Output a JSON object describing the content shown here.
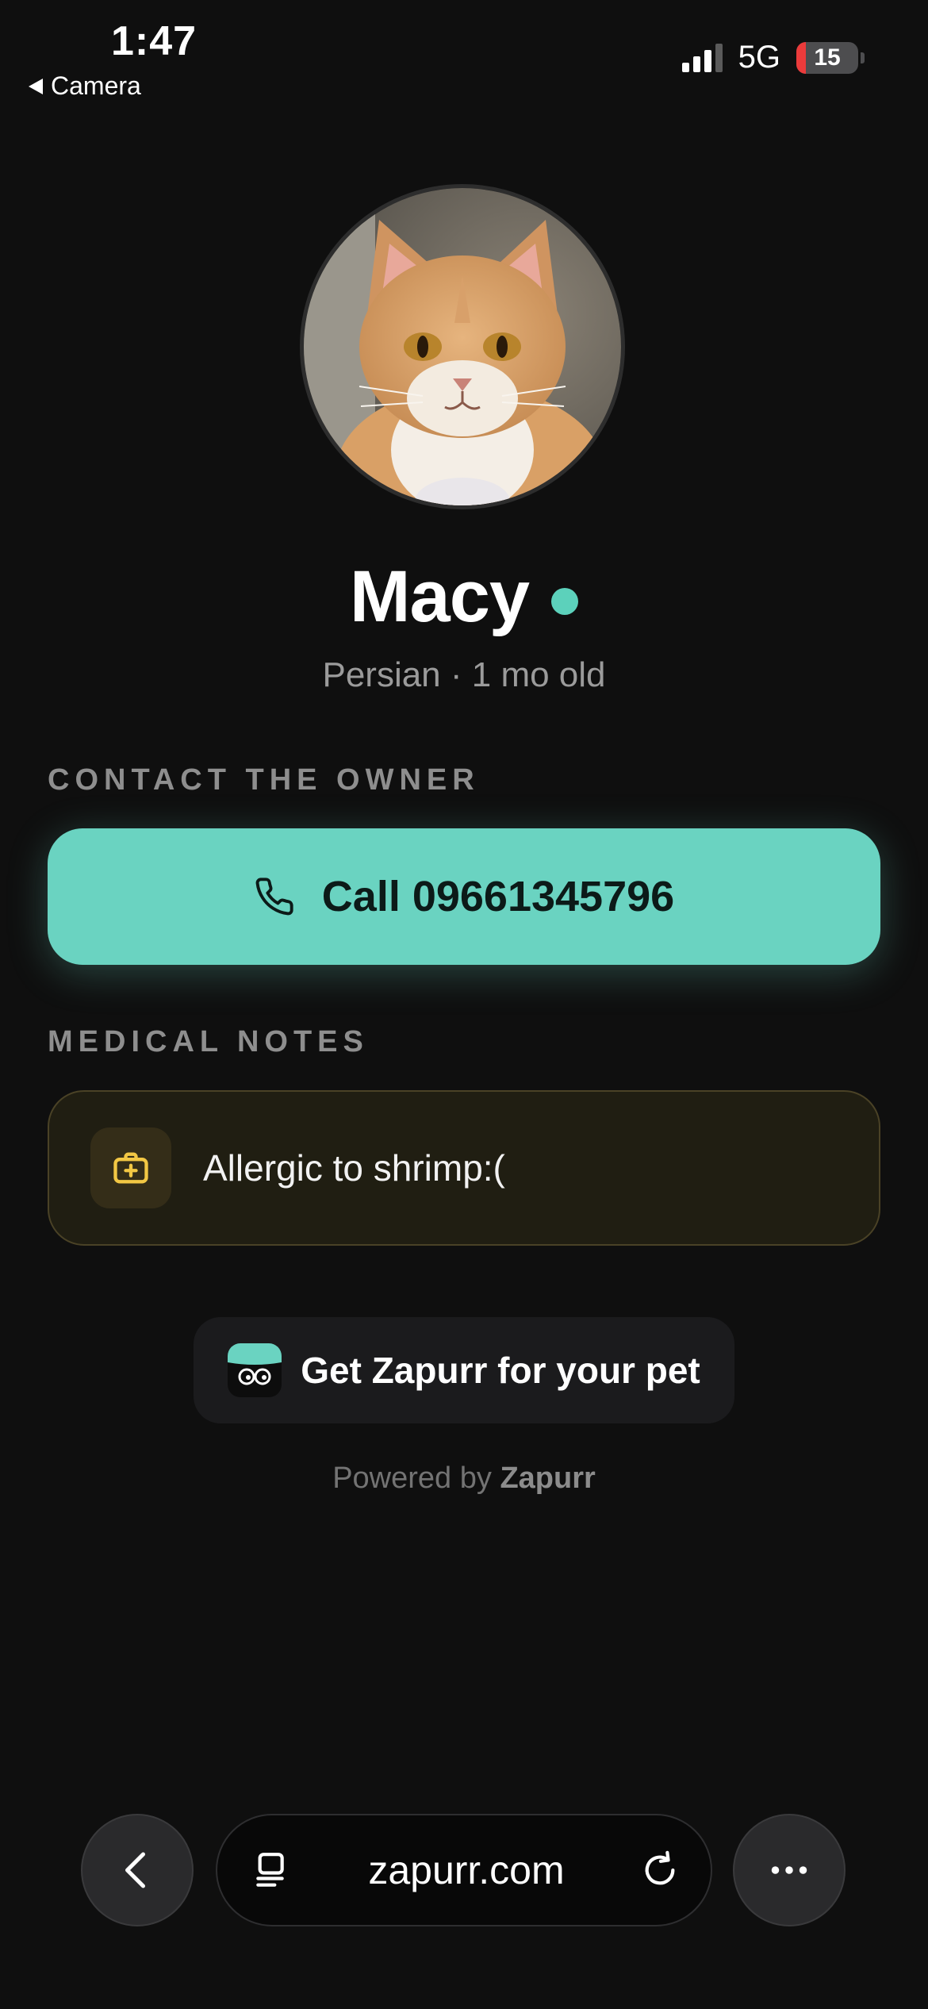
{
  "status_bar": {
    "time": "1:47",
    "back_label": "Camera",
    "network": "5G",
    "battery_level": "15",
    "battery_fraction": 0.15,
    "signal_bars": 3
  },
  "profile": {
    "name": "Macy",
    "breed": "Persian",
    "age": "1 mo old",
    "meta_separator": " · ",
    "online_color": "#5cd1bb"
  },
  "contact": {
    "section_label": "CONTACT THE OWNER",
    "call_label": "Call 09661345796",
    "accent_color": "#6ad3c1"
  },
  "medical": {
    "section_label": "MEDICAL NOTES",
    "note": "Allergic to shrimp:("
  },
  "promo": {
    "label": "Get Zapurr for your pet"
  },
  "footer": {
    "powered_prefix": "Powered by",
    "powered_brand": "Zapurr"
  },
  "browser": {
    "url": "zapurr.com"
  },
  "icons": {
    "back": "chevron-left-icon",
    "phone": "phone-icon",
    "medical": "medkit-icon",
    "tabs": "tab-overview-icon",
    "reload": "reload-icon",
    "more": "more-icon",
    "logo": "zapurr-logo-icon"
  }
}
